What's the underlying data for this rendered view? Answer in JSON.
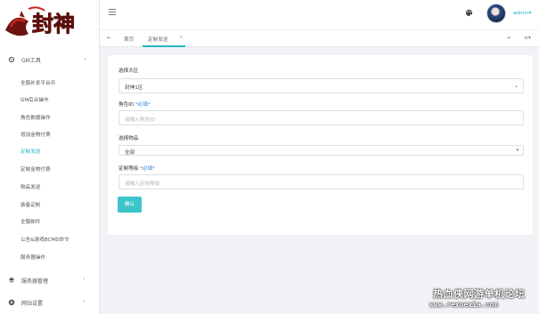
{
  "sidebar": {
    "group_gm": {
      "label": "GM工具",
      "icon": "gear-icon"
    },
    "items": [
      {
        "label": "全服补发平台币",
        "active": false
      },
      {
        "label": "GM后台操作",
        "active": false
      },
      {
        "label": "角色数据操作",
        "active": false
      },
      {
        "label": "增加金物付费",
        "active": false
      },
      {
        "label": "定制发送",
        "active": true
      },
      {
        "label": "定制金物付费",
        "active": false
      },
      {
        "label": "物品发送",
        "active": false
      },
      {
        "label": "装备定制",
        "active": false
      },
      {
        "label": "全服邮件",
        "active": false
      },
      {
        "label": "公告&游戏BCMD命令",
        "active": false
      },
      {
        "label": "服务器操作",
        "active": false
      }
    ],
    "group_server": {
      "label": "服务器管理",
      "icon": "server-icon"
    },
    "group_settings": {
      "label": "网站设置",
      "icon": "settings-icon"
    }
  },
  "topbar": {
    "user_name": "admin",
    "palette_icon": "palette-icon"
  },
  "tabs": {
    "home_label": "首页",
    "current_label": "定制发送"
  },
  "form": {
    "server_label": "选择大区",
    "server_value": "封神1区",
    "role_id_label": "角色ID",
    "role_id_required": "*必填*",
    "role_id_placeholder": "请输入角色ID",
    "item_label": "选择物品",
    "item_value": "全部",
    "quantity_label": "定制等级",
    "quantity_required": "*必填*",
    "quantity_placeholder": "请输入定制等级",
    "submit_label": "确认"
  },
  "logo": {
    "text": "封神"
  },
  "watermark": {
    "cn": "热血侠网游单机论坛",
    "url": "www.rexuexia.com"
  },
  "colors": {
    "accent": "#22b4c7",
    "button": "#3cc5c9",
    "logo_red": "#c8211c"
  }
}
